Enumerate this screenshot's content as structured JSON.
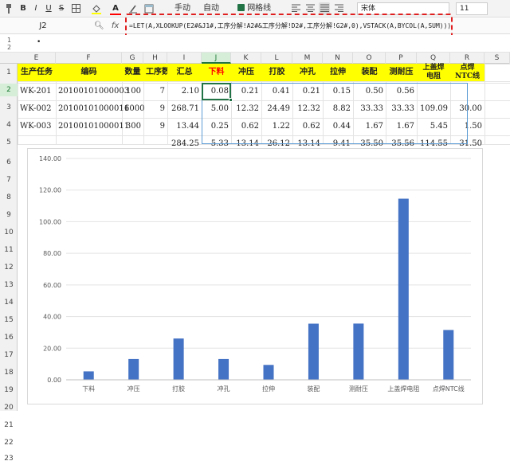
{
  "toolbar": {
    "items": [
      {
        "icon": "paintbrush-icon",
        "label": ""
      },
      {
        "icon": "bold-icon",
        "label": "B"
      },
      {
        "icon": "italic-icon",
        "label": "I"
      },
      {
        "icon": "underline-icon",
        "label": "U"
      },
      {
        "icon": "strikethrough-icon",
        "label": "S"
      },
      {
        "icon": "border-icon",
        "label": ""
      },
      {
        "icon": "fill-color-icon",
        "label": ""
      },
      {
        "icon": "font-color-icon",
        "label": "A"
      },
      {
        "icon": "clear-format-icon",
        "label": ""
      },
      {
        "icon": "cell-style-icon",
        "label": ""
      }
    ],
    "manual_label": "手动",
    "auto_label": "自动",
    "gridlines_label": "网格线",
    "font_name": "宋体",
    "font_size": "11",
    "accent": "#217346",
    "fill_color": "#ffff00",
    "font_color": "#ff0000"
  },
  "formula_bar": {
    "name_box": "J2",
    "fx_label": "fx",
    "formula": "=LET(A,XLOOKUP(E2#&J1#,工序分解!A2#&工序分解!D2#,工序分解!G2#,0),VSTACK(A,BYCOL(A,SUM)))",
    "highlight_color": "#e02020"
  },
  "outline": {
    "levels": [
      "1",
      "2"
    ],
    "dot": "•"
  },
  "columns": [
    "E",
    "F",
    "G",
    "H",
    "I",
    "J",
    "K",
    "L",
    "M",
    "N",
    "O",
    "P",
    "Q",
    "R",
    "S"
  ],
  "selected_column": "J",
  "rows": [
    "1",
    "2",
    "3",
    "4",
    "5",
    "6",
    "7",
    "8",
    "9",
    "10",
    "11",
    "12",
    "13",
    "14",
    "15",
    "16",
    "17",
    "18",
    "19",
    "20",
    "21",
    "22",
    "23"
  ],
  "selected_row": "2",
  "table": {
    "header": [
      "生产任务",
      "编码",
      "数量",
      "工序数",
      "汇总",
      "下料",
      "冲压",
      "打胶",
      "冲孔",
      "拉伸",
      "装配",
      "测耐压",
      "上盖焊电阻",
      "点焊NTC线"
    ],
    "header_multiline": {
      "上盖焊电阻": [
        "上盖焊",
        "电阻"
      ],
      "点焊NTC线": [
        "点焊",
        "NTC线"
      ]
    },
    "rows": [
      [
        "WK-201",
        "20100101000003",
        "100",
        "7",
        "2.10",
        "0.08",
        "0.21",
        "0.41",
        "0.21",
        "0.15",
        "0.50",
        "0.56",
        "",
        ""
      ],
      [
        "WK-002",
        "20100101000011",
        "6000",
        "9",
        "268.71",
        "5.00",
        "12.32",
        "24.49",
        "12.32",
        "8.82",
        "33.33",
        "33.33",
        "109.09",
        "30.00"
      ],
      [
        "WK-003",
        "20100101000011",
        "300",
        "9",
        "13.44",
        "0.25",
        "0.62",
        "1.22",
        "0.62",
        "0.44",
        "1.67",
        "1.67",
        "5.45",
        "1.50"
      ],
      [
        "",
        "",
        "",
        "",
        "284.25",
        "5.33",
        "13.14",
        "26.12",
        "13.14",
        "9.41",
        "35.50",
        "35.56",
        "114.55",
        "31.50"
      ]
    ],
    "header_bg": "#ffff00",
    "header_highlight_color": "#ff0000"
  },
  "chart_data": {
    "type": "bar",
    "categories": [
      "下料",
      "冲压",
      "打胶",
      "冲孔",
      "拉伸",
      "装配",
      "测耐压",
      "上盖焊电阻",
      "点焊NTC线"
    ],
    "values": [
      5.33,
      13.14,
      26.12,
      13.14,
      9.41,
      35.5,
      35.56,
      114.55,
      31.5
    ],
    "yticks": [
      "0.00",
      "20.00",
      "40.00",
      "60.00",
      "80.00",
      "100.00",
      "120.00",
      "140.00"
    ],
    "ylim": [
      0,
      140
    ],
    "grid": true,
    "title": "",
    "xlabel": "",
    "ylabel": "",
    "bar_color": "#4472c4"
  }
}
